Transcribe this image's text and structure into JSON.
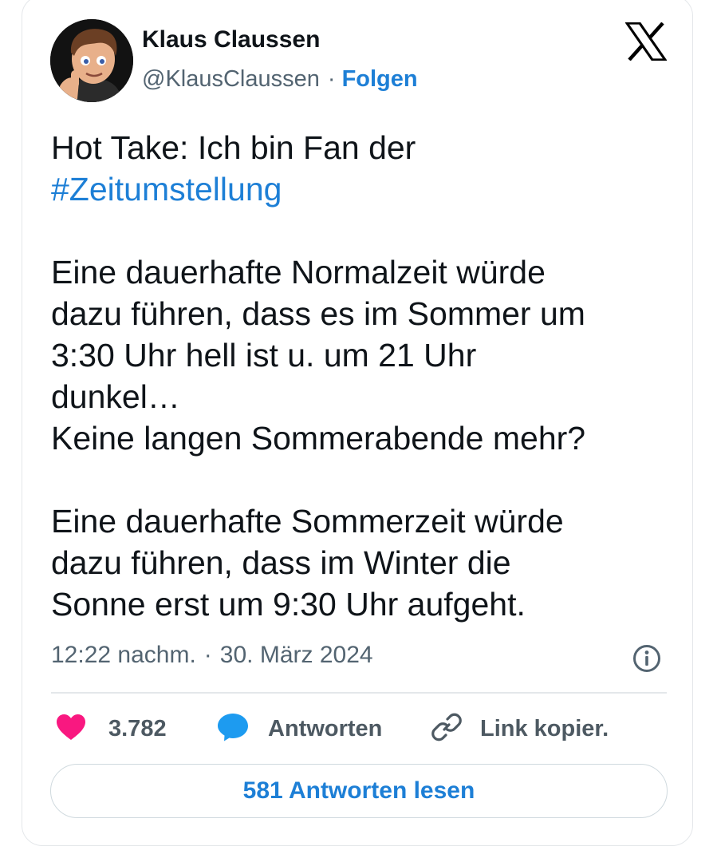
{
  "author": {
    "name": "Klaus Claussen",
    "handle": "@KlausClaussen",
    "separator": "·",
    "follow_label": "Folgen"
  },
  "platform_icon": "x-logo-icon",
  "tweet": {
    "line1_text": "Hot Take: Ich bin Fan der",
    "hashtag": "#Zeitumstellung",
    "paragraph2": [
      "Eine dauerhafte Normalzeit würde",
      "dazu führen, dass es im Sommer um",
      "3:30 Uhr hell ist u. um 21 Uhr",
      "dunkel…",
      "Keine langen Sommerabende mehr?"
    ],
    "paragraph3": [
      "Eine dauerhafte Sommerzeit würde",
      "dazu führen, dass im Winter die",
      "Sonne erst um 9:30 Uhr aufgeht."
    ]
  },
  "meta": {
    "time": "12:22 nachm.",
    "separator": "·",
    "date": "30. März 2024",
    "info_icon": "info-icon"
  },
  "actions": {
    "like_count": "3.782",
    "reply_label": "Antworten",
    "copy_link_label": "Link kopier."
  },
  "read_replies_label": "581 Antworten lesen",
  "colors": {
    "accent": "#1d7fd6",
    "like": "#f91880",
    "reply_icon": "#1d9bf0",
    "muted_text": "#536471"
  }
}
